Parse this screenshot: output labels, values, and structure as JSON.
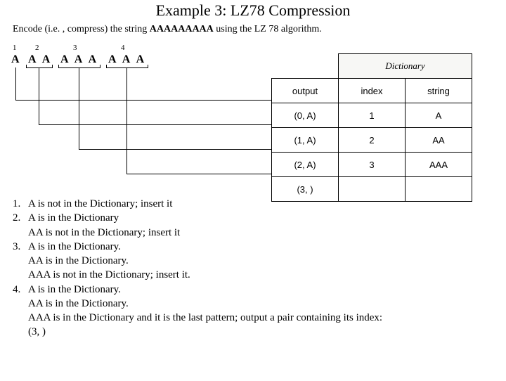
{
  "title": "Example 3: LZ78 Compression",
  "prompt_pre": "Encode (i.e. , compress) the string ",
  "prompt_bold": "AAAAAAAAA",
  "prompt_post": " using the LZ 78 algorithm.",
  "groups": {
    "g1": {
      "num": "1",
      "chars": "A"
    },
    "g2": {
      "num": "2",
      "chars": "A  A"
    },
    "g3": {
      "num": "3",
      "chars": "A  A  A"
    },
    "g4": {
      "num": "4",
      "chars": "A  A  A"
    }
  },
  "table": {
    "dict_header": "Dictionary",
    "cols": {
      "output": "output",
      "index": "index",
      "string": "string"
    },
    "rows": [
      {
        "output": "(0, A)",
        "index": "1",
        "string": "A"
      },
      {
        "output": "(1, A)",
        "index": "2",
        "string": "AA"
      },
      {
        "output": "(2, A)",
        "index": "3",
        "string": "AAA"
      },
      {
        "output": "(3,  )",
        "index": "",
        "string": ""
      }
    ]
  },
  "steps": [
    {
      "label": "1.",
      "lines": [
        "A is not in the Dictionary; insert it"
      ]
    },
    {
      "label": "2.",
      "lines": [
        "A is in the Dictionary",
        "AA is not in the Dictionary; insert it"
      ]
    },
    {
      "label": "3.",
      "lines": [
        "A is in the Dictionary.",
        "AA is in the Dictionary.",
        "AAA is not in the Dictionary; insert it."
      ]
    },
    {
      "label": "4.",
      "lines": [
        "A is in the Dictionary.",
        "AA is in the Dictionary.",
        "AAA is in the Dictionary and it is the last pattern; output a pair containing its index:",
        "(3,  )"
      ]
    }
  ]
}
